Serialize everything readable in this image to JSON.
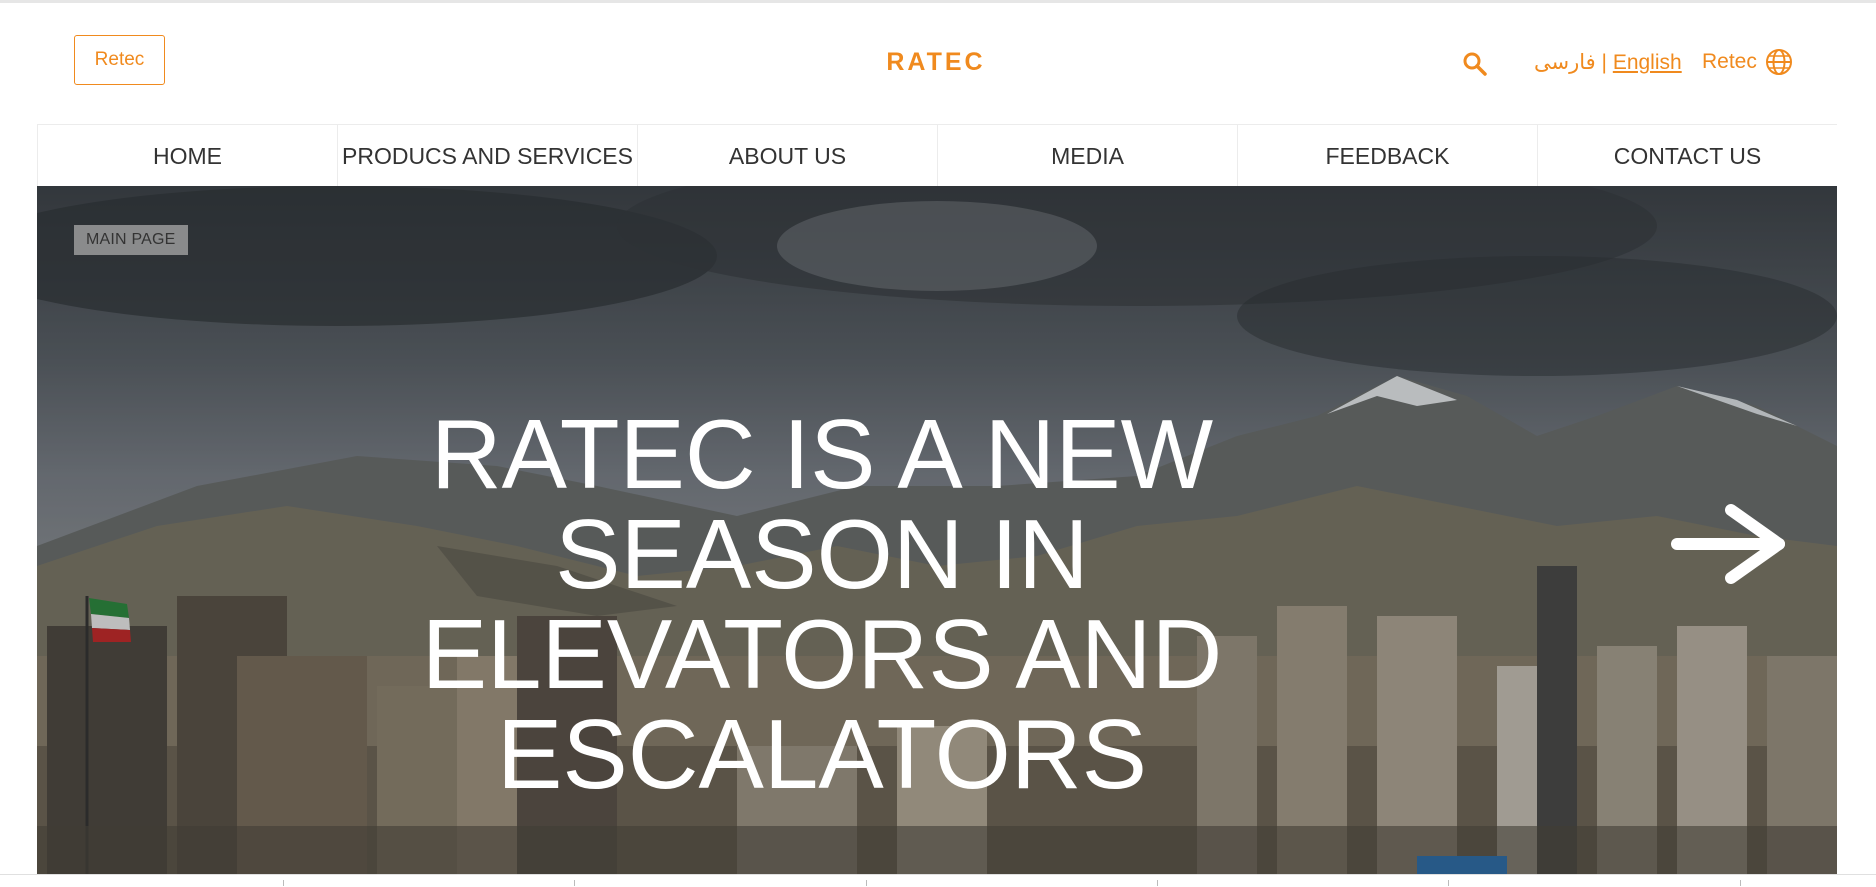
{
  "header": {
    "left_button": "Retec",
    "logo_text": "RATEC",
    "lang_fa": "فارسی",
    "lang_sep": " | ",
    "lang_en": "English",
    "brand_right": "Retec"
  },
  "nav": {
    "items": [
      "HOME",
      "PRODUCS AND SERVICES",
      "ABOUT US",
      "MEDIA",
      "FEEDBACK",
      "CONTACT US"
    ]
  },
  "hero": {
    "badge": "MAIN PAGE",
    "headline": "RATEC IS A NEW SEASON IN ELEVATORS AND ESCALATORS"
  },
  "colors": {
    "accent": "#f08a1e",
    "nav_text": "#333333",
    "headline": "#ffffff"
  },
  "icons": {
    "search": "search-icon",
    "globe": "globe-icon",
    "next": "arrow-right-icon"
  }
}
